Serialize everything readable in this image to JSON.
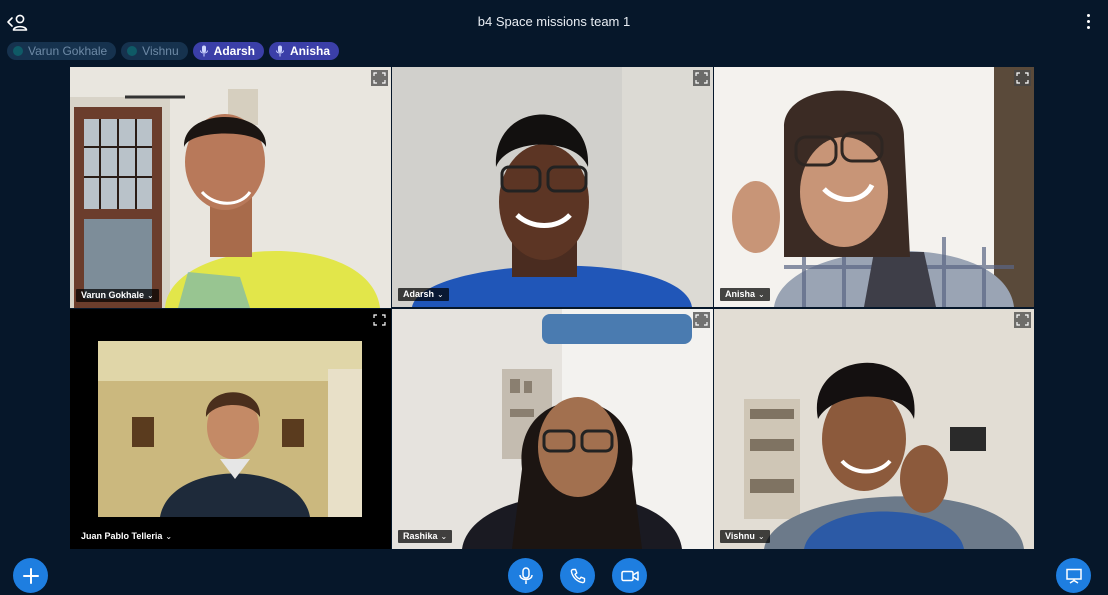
{
  "header": {
    "title": "b4 Space missions team 1"
  },
  "talkers": [
    {
      "name": "Varun Gokhale",
      "state": "idle"
    },
    {
      "name": "Vishnu",
      "state": "idle"
    },
    {
      "name": "Adarsh",
      "state": "active"
    },
    {
      "name": "Anisha",
      "state": "active"
    }
  ],
  "tiles": [
    {
      "name": "Varun Gokhale",
      "talking": false
    },
    {
      "name": "Adarsh",
      "talking": true
    },
    {
      "name": "Anisha",
      "talking": true
    },
    {
      "name": "Juan Pablo Telleria",
      "talking": false
    },
    {
      "name": "Rashika",
      "talking": false
    },
    {
      "name": "Vishnu",
      "talking": false
    }
  ],
  "controls": {
    "actions": "plus-icon",
    "microphone": "microphone-icon",
    "hangup": "phone-icon",
    "camera": "camera-icon",
    "presentation": "presentation-icon"
  },
  "colors": {
    "background": "#06172a",
    "accent": "#1e7ee0",
    "talking_border": "#2f7fd8",
    "chip_active": "#3b3fa8",
    "chip_idle": "#16324e"
  }
}
